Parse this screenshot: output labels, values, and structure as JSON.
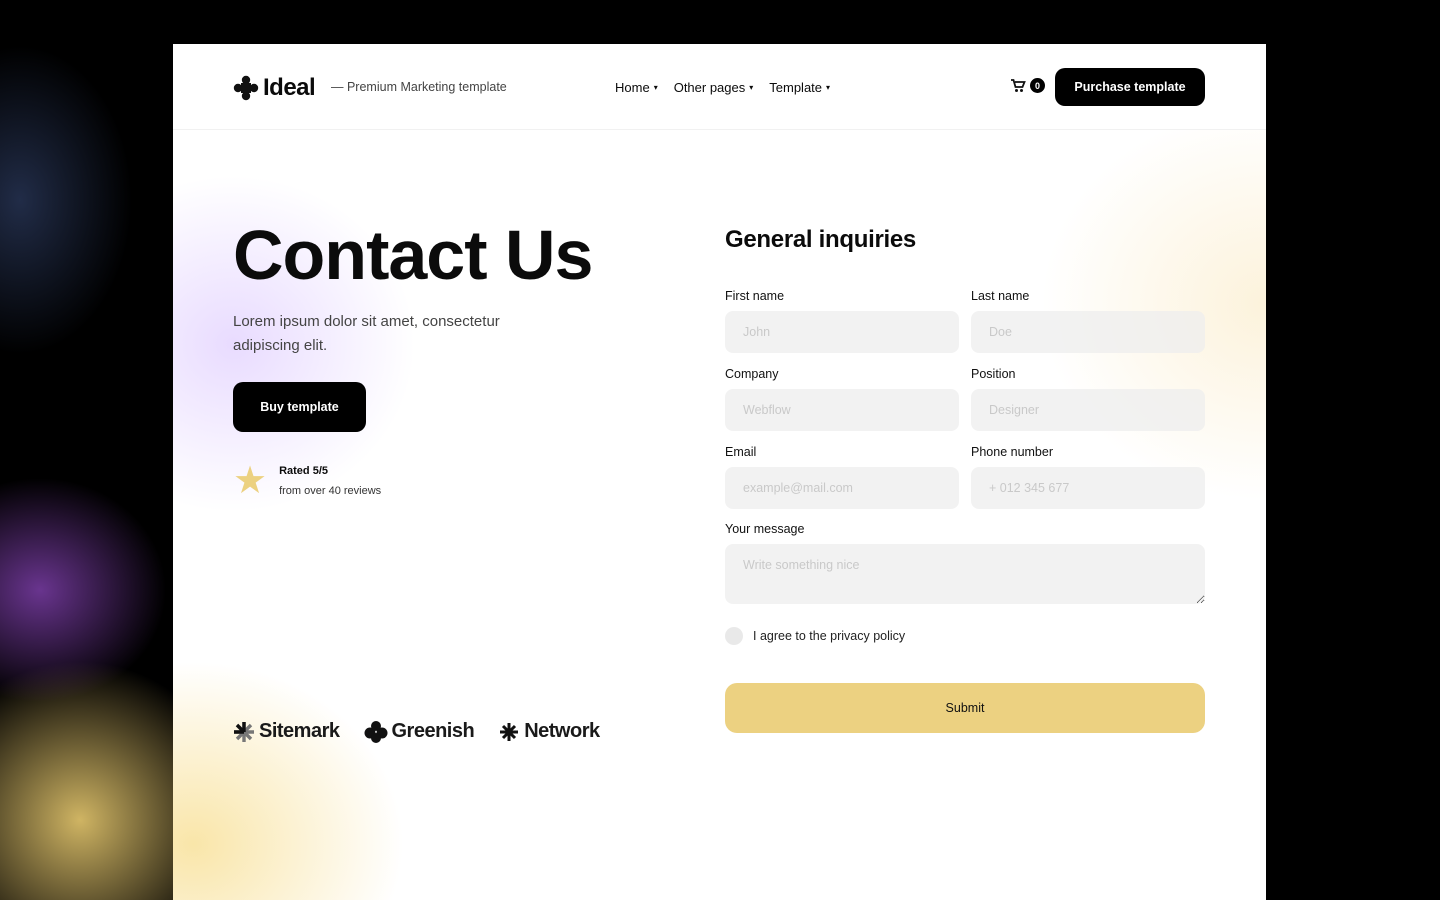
{
  "nav": {
    "logo_text": "Ideal",
    "tagline": "— Premium Marketing template",
    "menu": [
      {
        "label": "Home"
      },
      {
        "label": "Other pages"
      },
      {
        "label": "Template"
      }
    ],
    "cart_count": "0",
    "purchase_label": "Purchase template"
  },
  "hero": {
    "title": "Contact Us",
    "subtitle": "Lorem ipsum dolor sit amet, consectetur adipiscing elit.",
    "buy_label": "Buy template",
    "rating_title": "Rated 5/5",
    "rating_sub": "from over 40 reviews"
  },
  "brands": [
    {
      "name": "Sitemark",
      "icon": "sitemark-icon"
    },
    {
      "name": "Greenish",
      "icon": "greenish-icon"
    },
    {
      "name": "Network",
      "icon": "network-icon"
    }
  ],
  "form": {
    "title": "General inquiries",
    "fields": {
      "first_name": {
        "label": "First name",
        "placeholder": "John"
      },
      "last_name": {
        "label": "Last name",
        "placeholder": "Doe"
      },
      "company": {
        "label": "Company",
        "placeholder": "Webflow"
      },
      "position": {
        "label": "Position",
        "placeholder": "Designer"
      },
      "email": {
        "label": "Email",
        "placeholder": "example@mail.com"
      },
      "phone": {
        "label": "Phone number",
        "placeholder": "+ 012 345 677"
      }
    },
    "message": {
      "label": "Your message",
      "placeholder": "Write something nice"
    },
    "agree_label": "I agree to the privacy policy",
    "submit_label": "Submit"
  },
  "colors": {
    "accent": "#ecd181",
    "primary": "#000000"
  }
}
